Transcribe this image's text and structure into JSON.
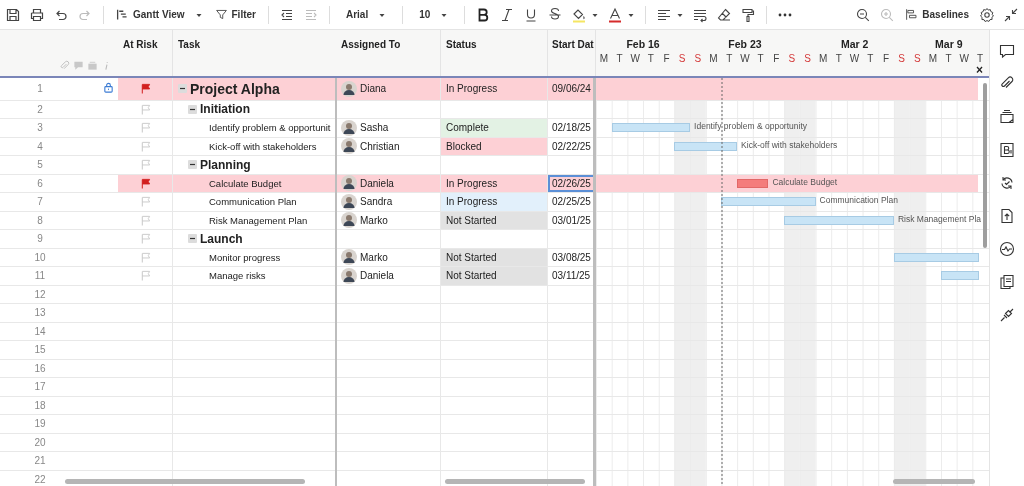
{
  "toolbar": {
    "view": "Gantt View",
    "filter": "Filter",
    "font": "Arial",
    "size": "10",
    "baselines": "Baselines"
  },
  "columns": [
    "At Risk",
    "Task",
    "Assigned To",
    "Status",
    "Start Dat"
  ],
  "gantt": {
    "weeks": [
      "Feb 16",
      "Feb 23",
      "Mar 2",
      "Mar 9"
    ],
    "close": "×",
    "days": [
      {
        "letter": "M",
        "weekend": false
      },
      {
        "letter": "T",
        "weekend": false
      },
      {
        "letter": "W",
        "weekend": false
      },
      {
        "letter": "T",
        "weekend": false
      },
      {
        "letter": "F",
        "weekend": false
      },
      {
        "letter": "S",
        "weekend": true
      },
      {
        "letter": "S",
        "weekend": true
      },
      {
        "letter": "M",
        "weekend": false
      },
      {
        "letter": "T",
        "weekend": false
      },
      {
        "letter": "W",
        "weekend": false
      },
      {
        "letter": "T",
        "weekend": false
      },
      {
        "letter": "F",
        "weekend": false
      },
      {
        "letter": "S",
        "weekend": true
      },
      {
        "letter": "S",
        "weekend": true
      },
      {
        "letter": "M",
        "weekend": false
      },
      {
        "letter": "T",
        "weekend": false
      },
      {
        "letter": "W",
        "weekend": false
      },
      {
        "letter": "T",
        "weekend": false
      },
      {
        "letter": "F",
        "weekend": false
      },
      {
        "letter": "S",
        "weekend": true
      },
      {
        "letter": "S",
        "weekend": true
      },
      {
        "letter": "M",
        "weekend": false
      },
      {
        "letter": "T",
        "weekend": false
      },
      {
        "letter": "W",
        "weekend": false
      },
      {
        "letter": "T",
        "weekend": false
      }
    ]
  },
  "rows": [
    {
      "num": "1",
      "kind": "project",
      "at_risk": true,
      "locked": true,
      "task": "Project Alpha",
      "expanded": true,
      "assignee": "Diana",
      "status": "In Progress",
      "start": "09/06/24",
      "selected": false,
      "children": [
        {
          "num": "2",
          "kind": "phase",
          "at_risk": false,
          "task": "Initiation",
          "expanded": true,
          "selected": false,
          "children": [
            {
              "num": "3",
              "kind": "task",
              "at_risk": false,
              "task": "Identify problem & opportunit",
              "assignee": "Sasha",
              "status": "Complete",
              "color": "#e3f2e4",
              "start": "02/18/25",
              "selected": false,
              "bar": {
                "label": "Identify problem & opportunity",
                "color": "#c8e4f6"
              }
            },
            {
              "num": "4",
              "kind": "task",
              "at_risk": false,
              "task": "Kick-off with stakeholders",
              "assignee": "Christian",
              "status": "Blocked",
              "color": "#fdd0d5",
              "start": "02/22/25",
              "selected": false,
              "bar": {
                "label": "Kick-off with stakeholders",
                "color": "#c8e4f6"
              }
            }
          ]
        },
        {
          "num": "5",
          "kind": "phase",
          "at_risk": false,
          "task": "Planning",
          "expanded": true,
          "selected": false,
          "children": [
            {
              "num": "6",
              "kind": "task",
              "at_risk": true,
              "task": "Calculate Budget",
              "assignee": "Daniela",
              "status": "In Progress",
              "start": "02/26/25",
              "selected": true,
              "bar": {
                "label": "Calculate Budget",
                "color": "#f47c7c"
              }
            },
            {
              "num": "7",
              "kind": "task",
              "at_risk": false,
              "task": "Communication Plan",
              "assignee": "Sandra",
              "status": "In Progress",
              "color": "#e2f0fb",
              "start": "02/25/25",
              "selected": false,
              "bar": {
                "label": "Communication Plan",
                "color": "#c8e4f6"
              }
            },
            {
              "num": "8",
              "kind": "task",
              "at_risk": false,
              "task": "Risk Management Plan",
              "assignee": "Marko",
              "status": "Not Started",
              "color": "#e2e2e2",
              "start": "03/01/25",
              "selected": false,
              "bar": {
                "label": "Risk Management Pla",
                "color": "#c8e4f6"
              }
            }
          ]
        },
        {
          "num": "9",
          "kind": "phase",
          "at_risk": false,
          "task": "Launch",
          "expanded": true,
          "selected": false,
          "children": [
            {
              "num": "10",
              "kind": "task",
              "at_risk": false,
              "task": "Monitor progress",
              "assignee": "Marko",
              "status": "Not Started",
              "color": "#e2e2e2",
              "start": "03/08/25",
              "selected": false,
              "bar": {
                "color": "#c8e4f6"
              }
            },
            {
              "num": "11",
              "kind": "task",
              "at_risk": false,
              "task": "Manage risks",
              "assignee": "Daniela",
              "status": "Not Started",
              "color": "#e2e2e2",
              "start": "03/11/25",
              "selected": false,
              "bar": {
                "color": "#c8e4f6"
              }
            }
          ]
        }
      ]
    }
  ],
  "empty_rows": [
    "12",
    "13",
    "14",
    "15",
    "16",
    "17",
    "18",
    "19",
    "20",
    "21",
    "22"
  ]
}
